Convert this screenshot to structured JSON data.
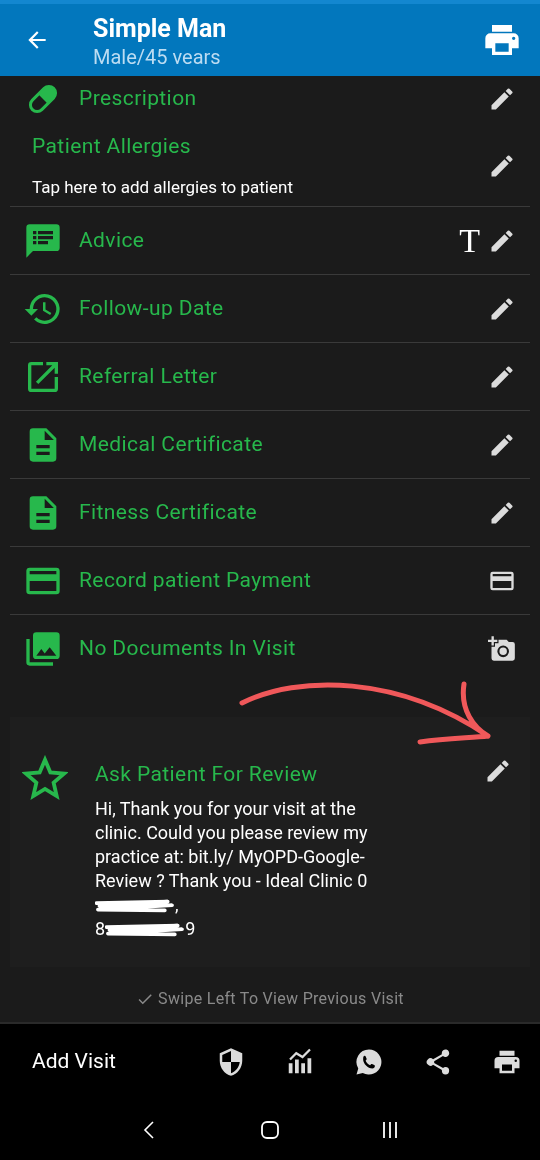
{
  "header": {
    "title": "Simple Man",
    "subtitle": "Male/45 vears"
  },
  "items": [
    {
      "kind": "pill",
      "label": "Prescription",
      "action": {
        "kind": "pencil"
      }
    },
    {
      "kind": "allergies",
      "label": "Patient Allergies",
      "subtitle": "Tap here to add allergies to patient",
      "action": {
        "kind": "pencil"
      }
    },
    {
      "kind": "chat",
      "label": "Advice",
      "action": {
        "kind": "pencil"
      },
      "extra": "T"
    },
    {
      "kind": "history",
      "label": "Follow-up Date",
      "action": {
        "kind": "pencil"
      }
    },
    {
      "kind": "launch",
      "label": "Referral Letter",
      "action": {
        "kind": "pencil"
      }
    },
    {
      "kind": "document",
      "label": "Medical Certificate",
      "action": {
        "kind": "pencil"
      }
    },
    {
      "kind": "document",
      "label": "Fitness Certificate",
      "action": {
        "kind": "pencil"
      }
    },
    {
      "kind": "card",
      "label": "Record patient Payment",
      "action": {
        "kind": "card"
      }
    },
    {
      "kind": "photos",
      "label": "No Documents In Visit",
      "action": {
        "kind": "camera"
      }
    }
  ],
  "review": {
    "title": "Ask Patient For Review",
    "message": [
      {
        "kind": "text",
        "text": "Hi, Thank you for your visit at the clinic. Could you please review my practice at: bit.ly/ MyOPD-Google-Review ? Thank you - Ideal Clinic 0"
      },
      {
        "kind": "redaction"
      },
      {
        "kind": "text",
        "text": ","
      },
      {
        "kind": "break"
      },
      {
        "kind": "text",
        "text": "8"
      },
      {
        "kind": "redaction"
      },
      {
        "kind": "text",
        "text": "9"
      }
    ]
  },
  "hint": "Swipe Left To View Previous Visit",
  "bottom_bar": {
    "button": "Add Visit",
    "icons": [
      {
        "kind": "shield"
      },
      {
        "kind": "chart"
      },
      {
        "kind": "whatsapp"
      },
      {
        "kind": "share"
      },
      {
        "kind": "print"
      }
    ]
  }
}
